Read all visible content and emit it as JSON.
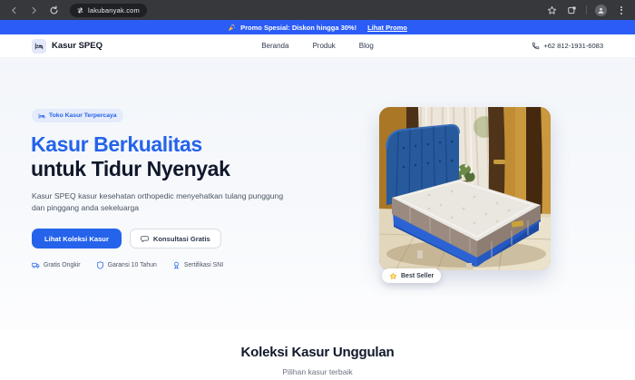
{
  "browser": {
    "url": "lakubanyak.com",
    "toolbar_icons": [
      "back-icon",
      "forward-icon",
      "reload-icon",
      "swap-icon",
      "bookmark-star-icon",
      "tab-switcher-icon",
      "profile-avatar",
      "menu-kebab-icon"
    ]
  },
  "banner": {
    "icon": "party-popper-icon",
    "text": "Promo Spesial: Diskon hingga 30%!",
    "link_label": "Lihat Promo"
  },
  "header": {
    "brand": "Kasur SPEQ",
    "nav": [
      {
        "label": "Beranda"
      },
      {
        "label": "Produk"
      },
      {
        "label": "Blog"
      }
    ],
    "phone": "+62 812-1931-6083"
  },
  "hero": {
    "badge_label": "Toko Kasur Terpercaya",
    "title_line1": "Kasur Berkualitas",
    "title_line2": "untuk Tidur Nyenyak",
    "description": "Kasur SPEQ kasur kesehatan orthopedic menyehatkan tulang punggung dan pinggang anda sekeluarga",
    "primary_cta": "Lihat Koleksi Kasur",
    "secondary_cta": "Konsultasi Gratis",
    "features": [
      {
        "icon": "truck-icon",
        "label": "Gratis Ongkir"
      },
      {
        "icon": "shield-icon",
        "label": "Garansi 10 Tahun"
      },
      {
        "icon": "certificate-icon",
        "label": "Sertifikasi SNI"
      }
    ],
    "image_badge": "Best Seller",
    "image_alt": "blue-upholstered-bed-with-white-mattress"
  },
  "collection": {
    "title": "Koleksi Kasur Unggulan",
    "subtitle": "Pilihan kasur terbaik"
  },
  "colors": {
    "accent": "#2563eb",
    "banner_blue": "#2b5cf6",
    "title_dark": "#10182b",
    "toolbar_dark": "#37383c"
  }
}
